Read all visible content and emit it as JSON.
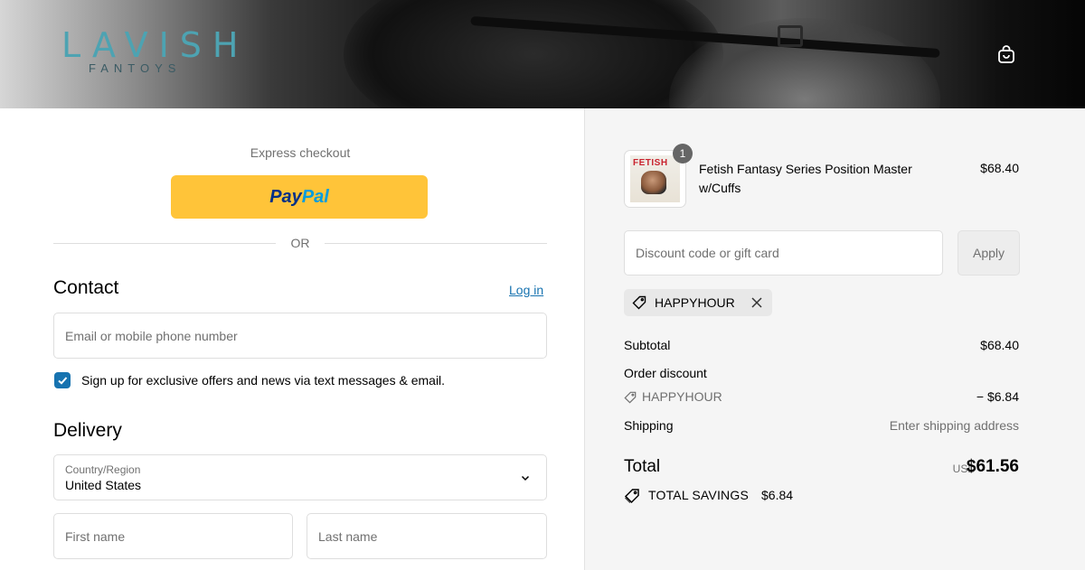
{
  "header": {
    "logo_main": "LAVISH",
    "logo_sub": "FANTOYS",
    "cart_icon": "shopping-bag-icon"
  },
  "express": {
    "label": "Express checkout",
    "paypal_pay": "Pay",
    "paypal_pal": "Pal",
    "or": "OR"
  },
  "contact": {
    "title": "Contact",
    "login": "Log in",
    "email_placeholder": "Email or mobile phone number",
    "signup_checked": true,
    "signup_label": "Sign up for exclusive offers and news via text messages & email."
  },
  "delivery": {
    "title": "Delivery",
    "country_label": "Country/Region",
    "country_value": "United States",
    "first_name_placeholder": "First name",
    "last_name_placeholder": "Last name"
  },
  "order": {
    "item": {
      "quantity": "1",
      "name": "Fetish Fantasy Series Position Master w/Cuffs",
      "price": "$68.40",
      "thumb_brand": "FETISH"
    },
    "discount_placeholder": "Discount code or gift card",
    "apply_label": "Apply",
    "applied_code": "HAPPYHOUR",
    "subtotal_label": "Subtotal",
    "subtotal_value": "$68.40",
    "order_discount_label": "Order discount",
    "discount_code": "HAPPYHOUR",
    "discount_value": "− $6.84",
    "shipping_label": "Shipping",
    "shipping_value": "Enter shipping address",
    "total_label": "Total",
    "currency": "USD",
    "total_value": "$61.56",
    "savings_label": "TOTAL SAVINGS",
    "savings_value": "$6.84"
  },
  "colors": {
    "paypal_yellow": "#ffc439",
    "link_blue": "#1773b0",
    "logo_teal": "#4da3b2"
  }
}
